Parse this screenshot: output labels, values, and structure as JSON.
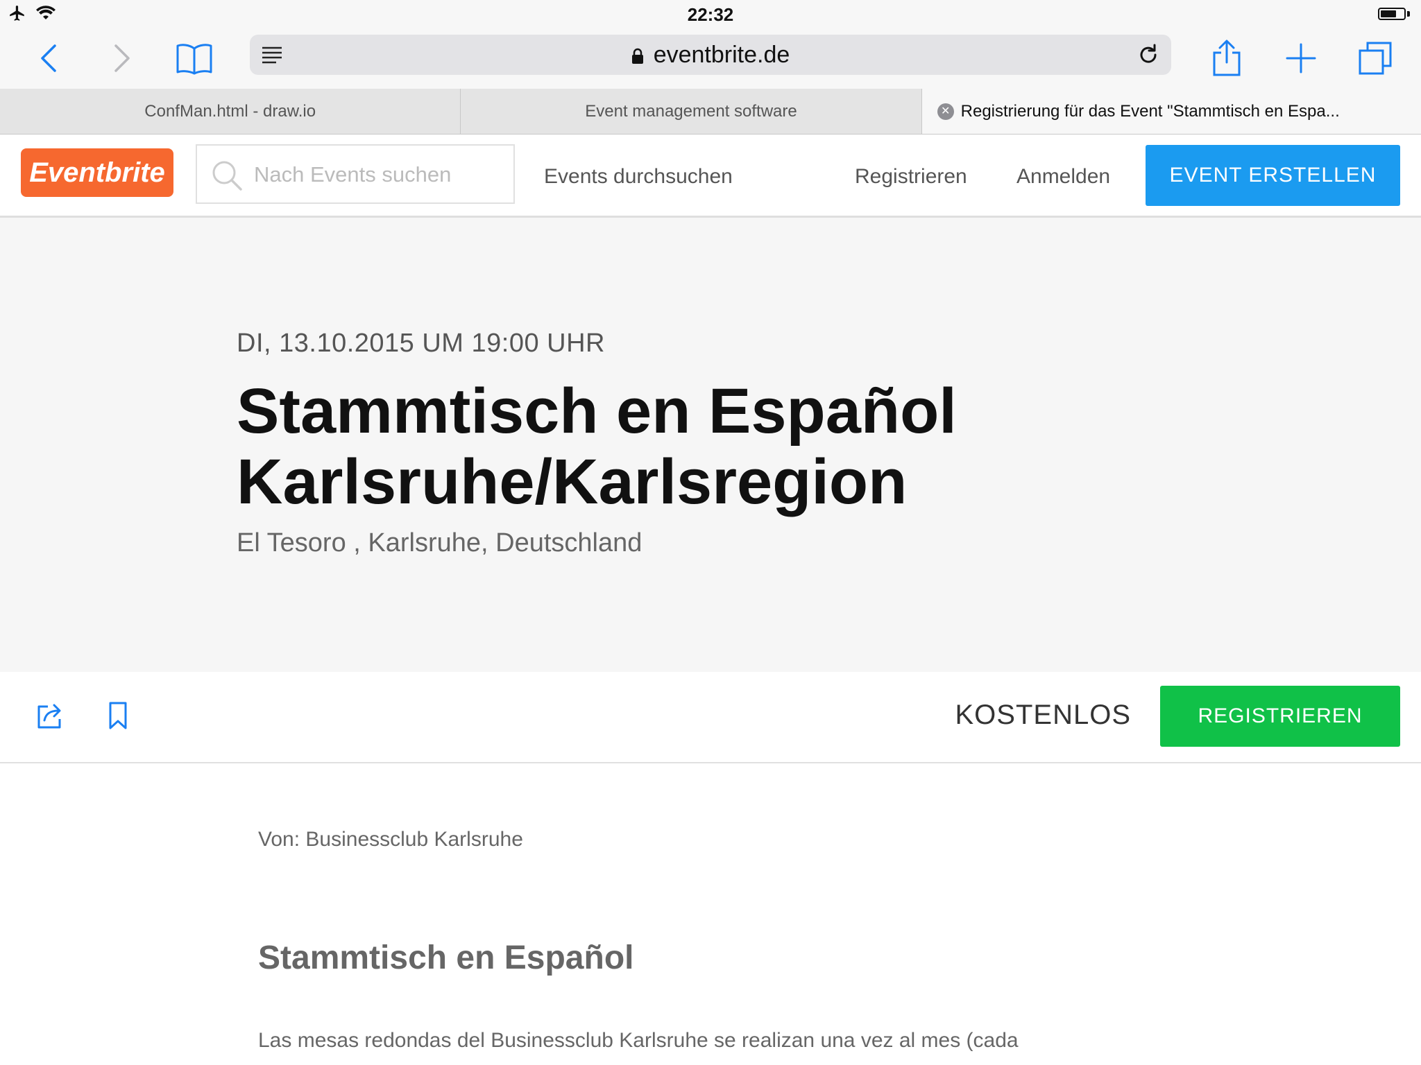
{
  "status_bar": {
    "time": "22:32"
  },
  "browser": {
    "url": "eventbrite.de",
    "tabs": [
      {
        "label": "ConfMan.html - draw.io"
      },
      {
        "label": "Event management software"
      },
      {
        "label": "Registrierung für das Event \"Stammtisch en Espa..."
      }
    ]
  },
  "header": {
    "logo_text": "Eventbrite",
    "search_placeholder": "Nach Events suchen",
    "nav_browse": "Events durchsuchen",
    "nav_register": "Registrieren",
    "nav_login": "Anmelden",
    "create_button": "EVENT ERSTELLEN",
    "brand_color": "#f6682f",
    "create_color": "#1b9bf0"
  },
  "event": {
    "date": "DI, 13.10.2015 UM 19:00 UHR",
    "title_line1": "Stammtisch en Español",
    "title_line2": "Karlsruhe/Karlsregion",
    "location": "El Tesoro , Karlsruhe, Deutschland",
    "price": "KOSTENLOS",
    "register_button": "REGISTRIEREN",
    "register_color": "#10c148"
  },
  "content": {
    "organizer": "Von: Businessclub Karlsruhe",
    "section_title": "Stammtisch en Español",
    "description": "Las mesas redondas del Businessclub Karlsruhe se realizan una vez al mes (cada"
  }
}
